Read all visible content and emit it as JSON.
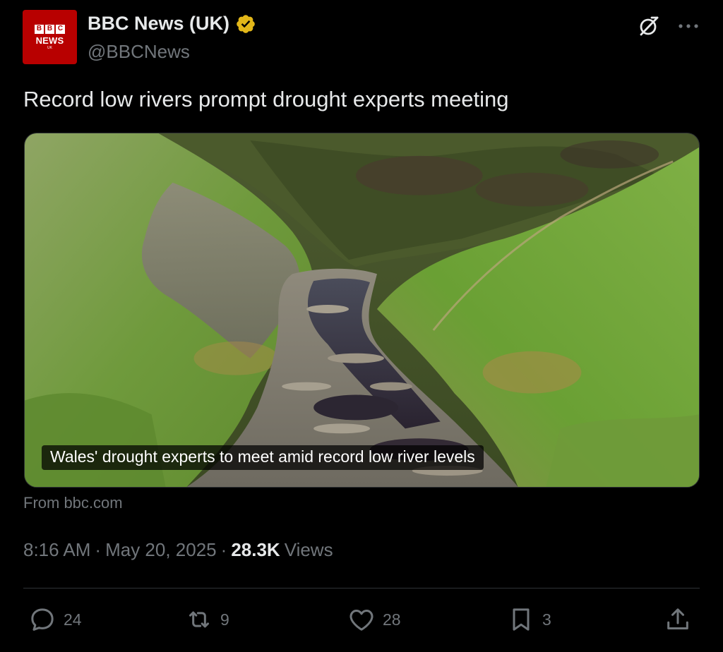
{
  "account": {
    "display_name": "BBC News (UK)",
    "handle": "@BBCNews",
    "verified": true,
    "avatar_letters": [
      "B",
      "B",
      "C"
    ],
    "avatar_news": "NEWS",
    "avatar_region": "UK",
    "brand_color": "#b80000"
  },
  "tweet": {
    "text": "Record low rivers prompt drought experts meeting",
    "card_caption": "Wales' drought experts to meet amid record low river levels",
    "source": "From bbc.com",
    "time": "8:16 AM",
    "date": "May 20, 2025",
    "views_count": "28.3K",
    "views_label": "Views"
  },
  "actions": {
    "reply_count": "24",
    "repost_count": "9",
    "like_count": "28",
    "bookmark_count": "3"
  },
  "icons": {
    "verified": "verified-badge-icon",
    "grok": "grok-icon",
    "more": "more-icon",
    "reply": "reply-icon",
    "repost": "repost-icon",
    "like": "heart-icon",
    "bookmark": "bookmark-icon",
    "share": "share-icon"
  },
  "colors": {
    "background": "#000000",
    "text": "#e7e9ea",
    "secondary": "#71767b",
    "verified_gold": "#e2b719"
  }
}
